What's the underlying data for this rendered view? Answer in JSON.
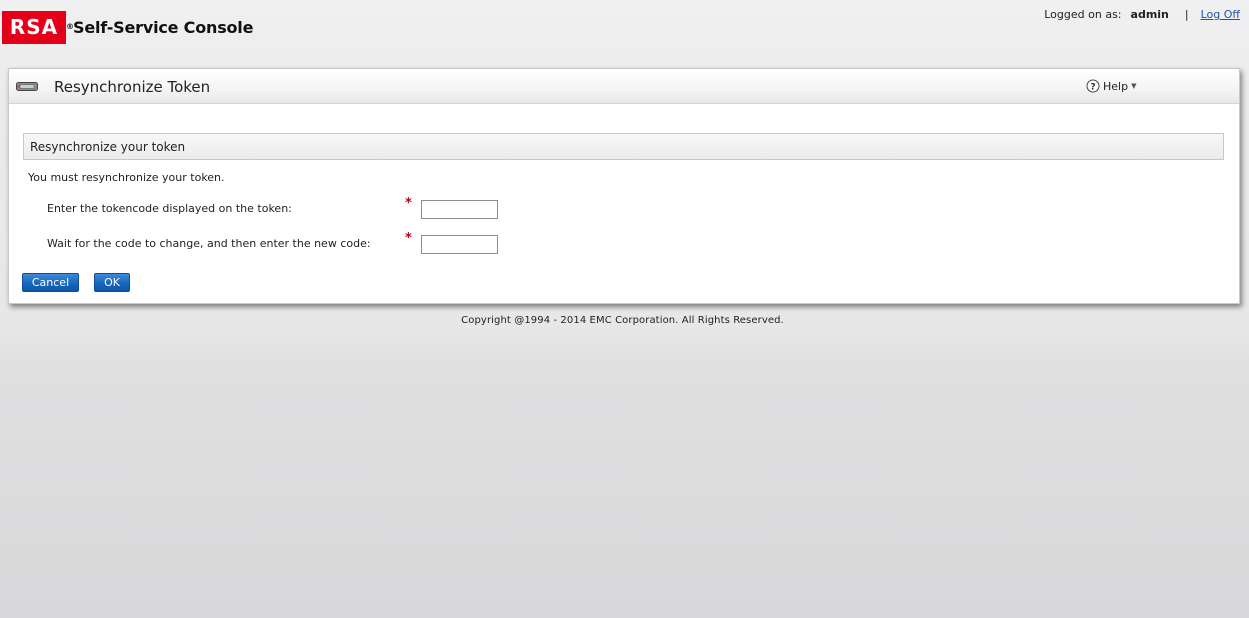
{
  "header": {
    "logo_text": "RSA",
    "logo_registered": "®",
    "app_title": "Self-Service Console",
    "logged_on_label": "Logged on as:",
    "user": "admin",
    "separator": "|",
    "logoff_label": "Log Off"
  },
  "page": {
    "title": "Resynchronize Token",
    "help_label": "Help",
    "section_title": "Resynchronize your token",
    "instruction": "You must resynchronize your token.",
    "fields": [
      {
        "label": "Enter the tokencode displayed on the token:",
        "required_marker": "*",
        "value": ""
      },
      {
        "label": "Wait for the code to change, and then enter the new code:",
        "required_marker": "*",
        "value": ""
      }
    ],
    "buttons": {
      "cancel": "Cancel",
      "ok": "OK"
    }
  },
  "footer": {
    "copyright": "Copyright @1994 - 2014 EMC Corporation. All Rights Reserved."
  },
  "colors": {
    "brand_red": "#e4001b",
    "button_blue": "#1667bb",
    "link_blue": "#1a56b0",
    "required_red": "#c0001a"
  },
  "icons": {
    "token": "token-icon",
    "help": "help-circle-icon",
    "help_caret": "chevron-down-icon"
  }
}
